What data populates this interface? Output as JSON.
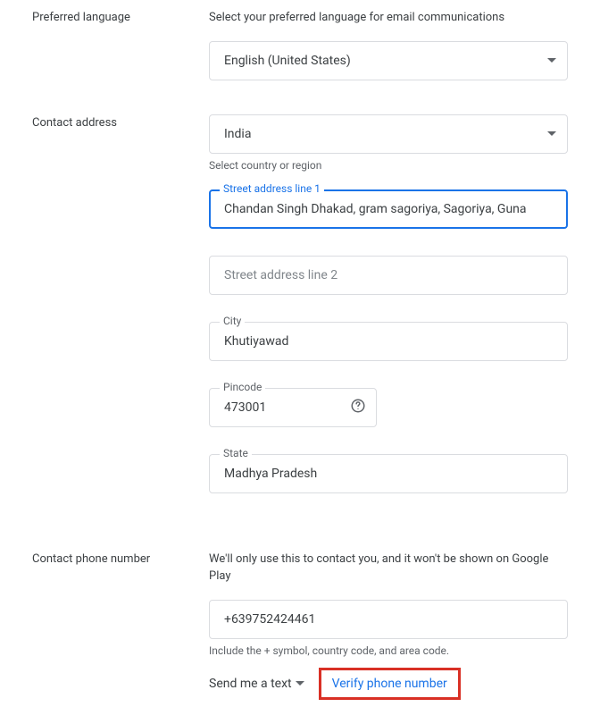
{
  "preferredLanguage": {
    "label": "Preferred language",
    "description": "Select your preferred language for email communications",
    "value": "English (United States)"
  },
  "contactAddress": {
    "label": "Contact address",
    "country": {
      "value": "India",
      "helper": "Select country or region"
    },
    "street1": {
      "label": "Street address line 1",
      "value": "Chandan Singh Dhakad, gram sagoriya, Sagoriya, Guna"
    },
    "street2": {
      "placeholder": "Street address line 2",
      "value": ""
    },
    "city": {
      "label": "City",
      "value": "Khutiyawad"
    },
    "pincode": {
      "label": "Pincode",
      "value": "473001"
    },
    "state": {
      "label": "State",
      "value": "Madhya Pradesh"
    }
  },
  "contactPhone": {
    "label": "Contact phone number",
    "description": "We'll only use this to contact you, and it won't be shown on Google Play",
    "value": "+639752424461",
    "helper": "Include the + symbol, country code, and area code.",
    "sendText": "Send me a text",
    "verify": "Verify phone number"
  }
}
